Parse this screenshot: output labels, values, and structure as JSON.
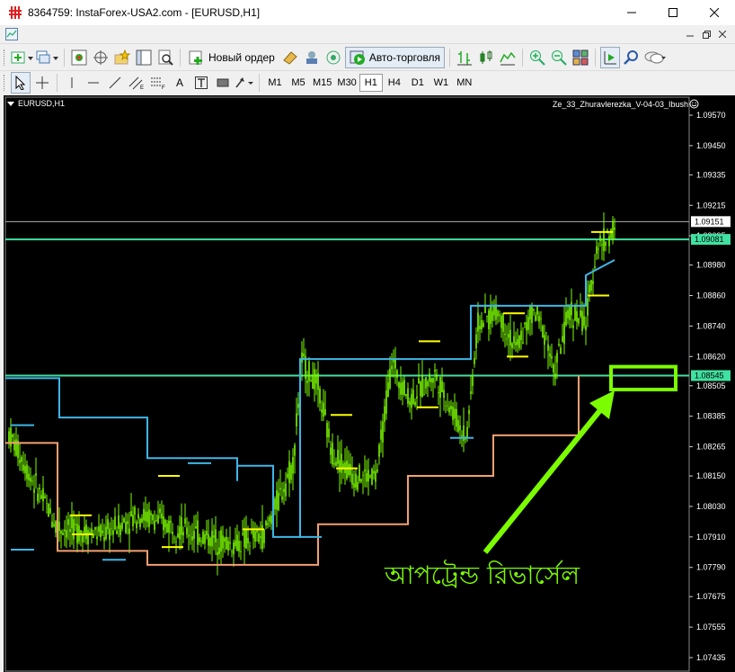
{
  "window": {
    "title": "8364759: InstaForex-USA2.com - [EURUSD,H1]",
    "controls": [
      "minimize",
      "maximize",
      "close"
    ]
  },
  "toolbar1": {
    "new_order_label": "Новый ордер",
    "autotrading_label": "Авто-торговля"
  },
  "toolbar2": {
    "text_tool": "A",
    "timeframes": [
      "M1",
      "M5",
      "M15",
      "M30",
      "H1",
      "H4",
      "D1",
      "W1",
      "MN"
    ],
    "active_timeframe": "H1"
  },
  "chart": {
    "symbol_label": "EURUSD,H1",
    "indicator_label": "Ze_33_Zhuravlerezka_V-04-03_Ibush",
    "annotation_text": "আপট্রেন্ড রিভার্সেল",
    "colors": {
      "background": "#000000",
      "candles": "#7cfc00",
      "upper_band": "#3fb6e8",
      "lower_band": "#f4a070",
      "levels": "#ffff00",
      "horizontal_lines": "#40e0a0",
      "bid_line": "#b0b0b0",
      "annotation": "#7cfc00"
    },
    "price_axis": [
      "1.09570",
      "1.09450",
      "1.09335",
      "1.09215",
      "1.09095",
      "1.08980",
      "1.08860",
      "1.08740",
      "1.08620",
      "1.08505",
      "1.08385",
      "1.08265",
      "1.08150",
      "1.08030",
      "1.07910",
      "1.07790",
      "1.07675",
      "1.07555",
      "1.07435"
    ],
    "price_markers": [
      {
        "price": "1.09151",
        "style": "bid"
      },
      {
        "price": "1.09081",
        "style": "level"
      },
      {
        "price": "1.08545",
        "style": "level"
      }
    ]
  }
}
